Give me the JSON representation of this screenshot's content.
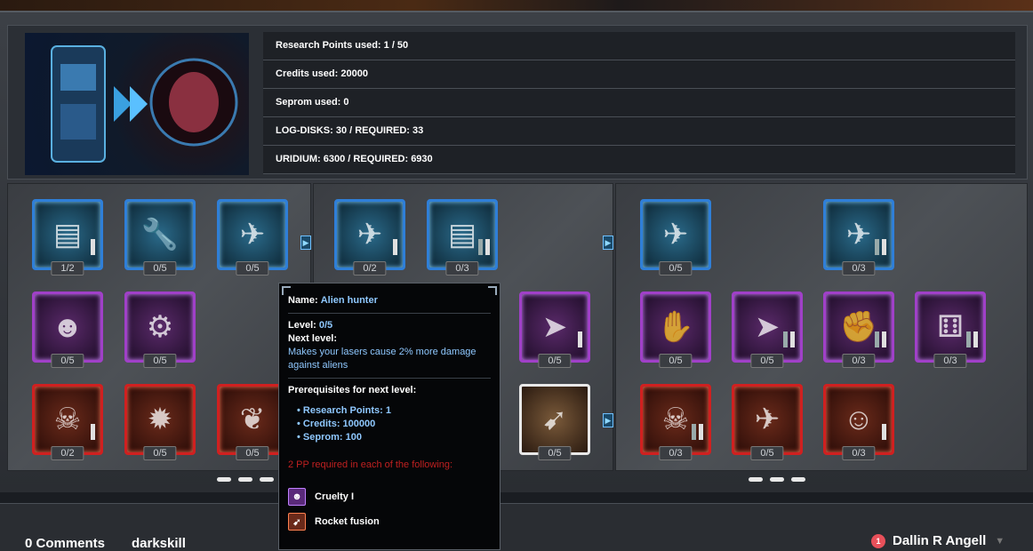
{
  "stats": {
    "research_points": "Research Points used: 1 / 50",
    "credits": "Credits used: 20000",
    "seprom": "Seprom used: 0",
    "log_disks": "LOG-DISKS: 30 / REQUIRED: 33",
    "uridium": "URIDIUM: 6300 / REQUIRED: 6930"
  },
  "skills": {
    "t1": [
      "1/2",
      "0/5",
      "0/5"
    ],
    "t2": [
      "0/5",
      "0/5"
    ],
    "t3": [
      "0/2",
      "0/5",
      "0/5"
    ],
    "m1": [
      "0/2",
      "0/3"
    ],
    "m2": [
      "0/5"
    ],
    "m3": [
      "0/5"
    ],
    "r1": [
      "0/5",
      "0/3"
    ],
    "r2": [
      "0/5",
      "0/5",
      "0/3",
      "0/3"
    ],
    "r3": [
      "0/3",
      "0/5",
      "0/3"
    ]
  },
  "tooltip": {
    "name_label": "Name:",
    "name_value": "Alien hunter",
    "level_label": "Level:",
    "level_value": "0/5",
    "next_level_label": "Next level:",
    "next_level_desc": "Makes your lasers cause 2% more damage against aliens",
    "prereq_title": "Prerequisites for next level:",
    "prereqs": [
      {
        "label": "Research Points:",
        "value": "1"
      },
      {
        "label": "Credits:",
        "value": "100000"
      },
      {
        "label": "Seprom:",
        "value": "100"
      }
    ],
    "pp_required": "2 PP required in each of the following:",
    "requirements": [
      "Cruelty I",
      "Rocket fusion"
    ]
  },
  "footer": {
    "comments": "0 Comments",
    "username": "darkskill",
    "notification_count": "1",
    "user_name": "Dallin R Angell"
  },
  "colors": {
    "blue_frame": "#2f7fd8",
    "purple_frame": "#a040c8",
    "red_frame": "#d02020",
    "accent_text": "#8fc8ff",
    "warning_text": "#c02020"
  }
}
